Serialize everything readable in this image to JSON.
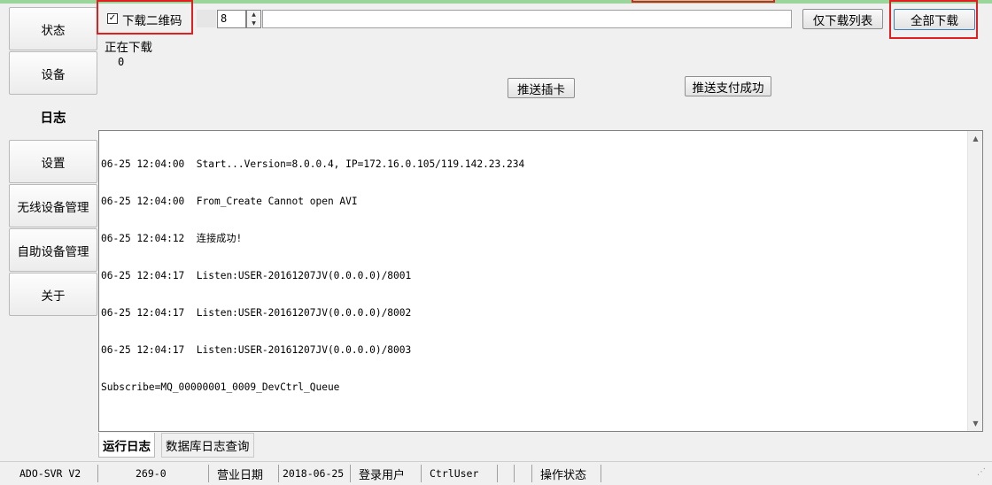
{
  "nav": {
    "items": [
      {
        "label": "状态"
      },
      {
        "label": "设备"
      },
      {
        "label": "日志"
      },
      {
        "label": "设置"
      },
      {
        "label": "无线设备管理"
      },
      {
        "label": "自助设备管理"
      },
      {
        "label": "关于"
      }
    ],
    "active": "日志"
  },
  "toolbar": {
    "download_qr_label": "下载二维码",
    "download_qr_checked": true,
    "spinner_value": "8",
    "path_value": "",
    "download_list_label": "仅下载列表",
    "download_all_label": "全部下载"
  },
  "download_status": {
    "label": "正在下载",
    "count": "0"
  },
  "actions": {
    "push_card_label": "推送插卡",
    "push_payment_label": "推送支付成功"
  },
  "log": {
    "lines": [
      "06-25 12:04:00  Start...Version=8.0.0.4, IP=172.16.0.105/119.142.23.234",
      "06-25 12:04:00  From_Create Cannot open AVI",
      "06-25 12:04:12  连接成功!",
      "06-25 12:04:17  Listen:USER-20161207JV(0.0.0.0)/8001",
      "06-25 12:04:17  Listen:USER-20161207JV(0.0.0.0)/8002",
      "06-25 12:04:17  Listen:USER-20161207JV(0.0.0.0)/8003",
      "Subscribe=MQ_00000001_0009_DevCtrl_Queue"
    ]
  },
  "tabs": [
    {
      "label": "运行日志"
    },
    {
      "label": "数据库日志查询"
    }
  ],
  "status_bar": {
    "app_version": "ADO-SVR V2",
    "code": "269-0",
    "business_date_label": "营业日期",
    "business_date_value": "2018-06-25",
    "login_user_label": "登录用户",
    "login_user_value": "CtrlUser",
    "operation_status_label": "操作状态"
  },
  "colors": {
    "highlight_box": "#e02020",
    "top_strip": "#9ad59b"
  }
}
